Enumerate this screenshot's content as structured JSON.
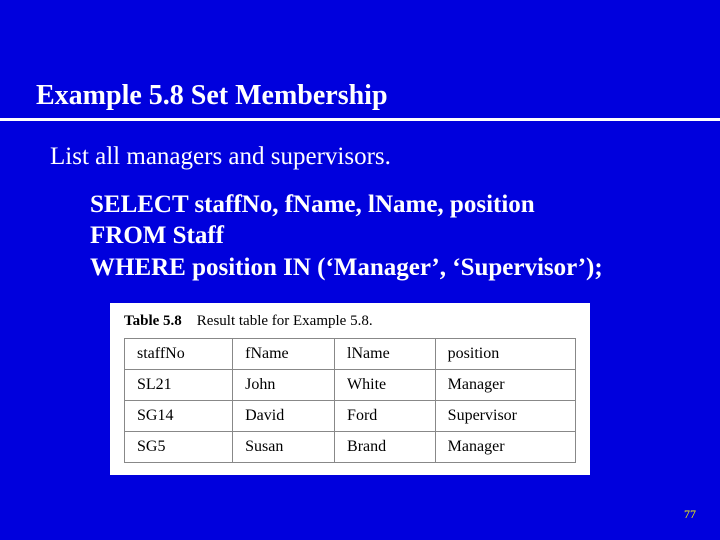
{
  "title": "Example 5.8  Set Membership",
  "prompt": "List all managers and supervisors.",
  "sql": {
    "line1": "SELECT staffNo, fName, lName, position",
    "line2": "FROM Staff",
    "line3": "WHERE position IN (‘Manager’, ‘Supervisor’);"
  },
  "table": {
    "caption_label": "Table 5.8",
    "caption_rest": "Result table for Example 5.8.",
    "headers": [
      "staffNo",
      "fName",
      "lName",
      "position"
    ],
    "rows": [
      [
        "SL21",
        "John",
        "White",
        "Manager"
      ],
      [
        "SG14",
        "David",
        "Ford",
        "Supervisor"
      ],
      [
        "SG5",
        "Susan",
        "Brand",
        "Manager"
      ]
    ]
  },
  "page_number": "77",
  "chart_data": {
    "type": "table",
    "title": "Table 5.8  Result table for Example 5.8.",
    "columns": [
      "staffNo",
      "fName",
      "lName",
      "position"
    ],
    "rows": [
      {
        "staffNo": "SL21",
        "fName": "John",
        "lName": "White",
        "position": "Manager"
      },
      {
        "staffNo": "SG14",
        "fName": "David",
        "lName": "Ford",
        "position": "Supervisor"
      },
      {
        "staffNo": "SG5",
        "fName": "Susan",
        "lName": "Brand",
        "position": "Manager"
      }
    ]
  }
}
